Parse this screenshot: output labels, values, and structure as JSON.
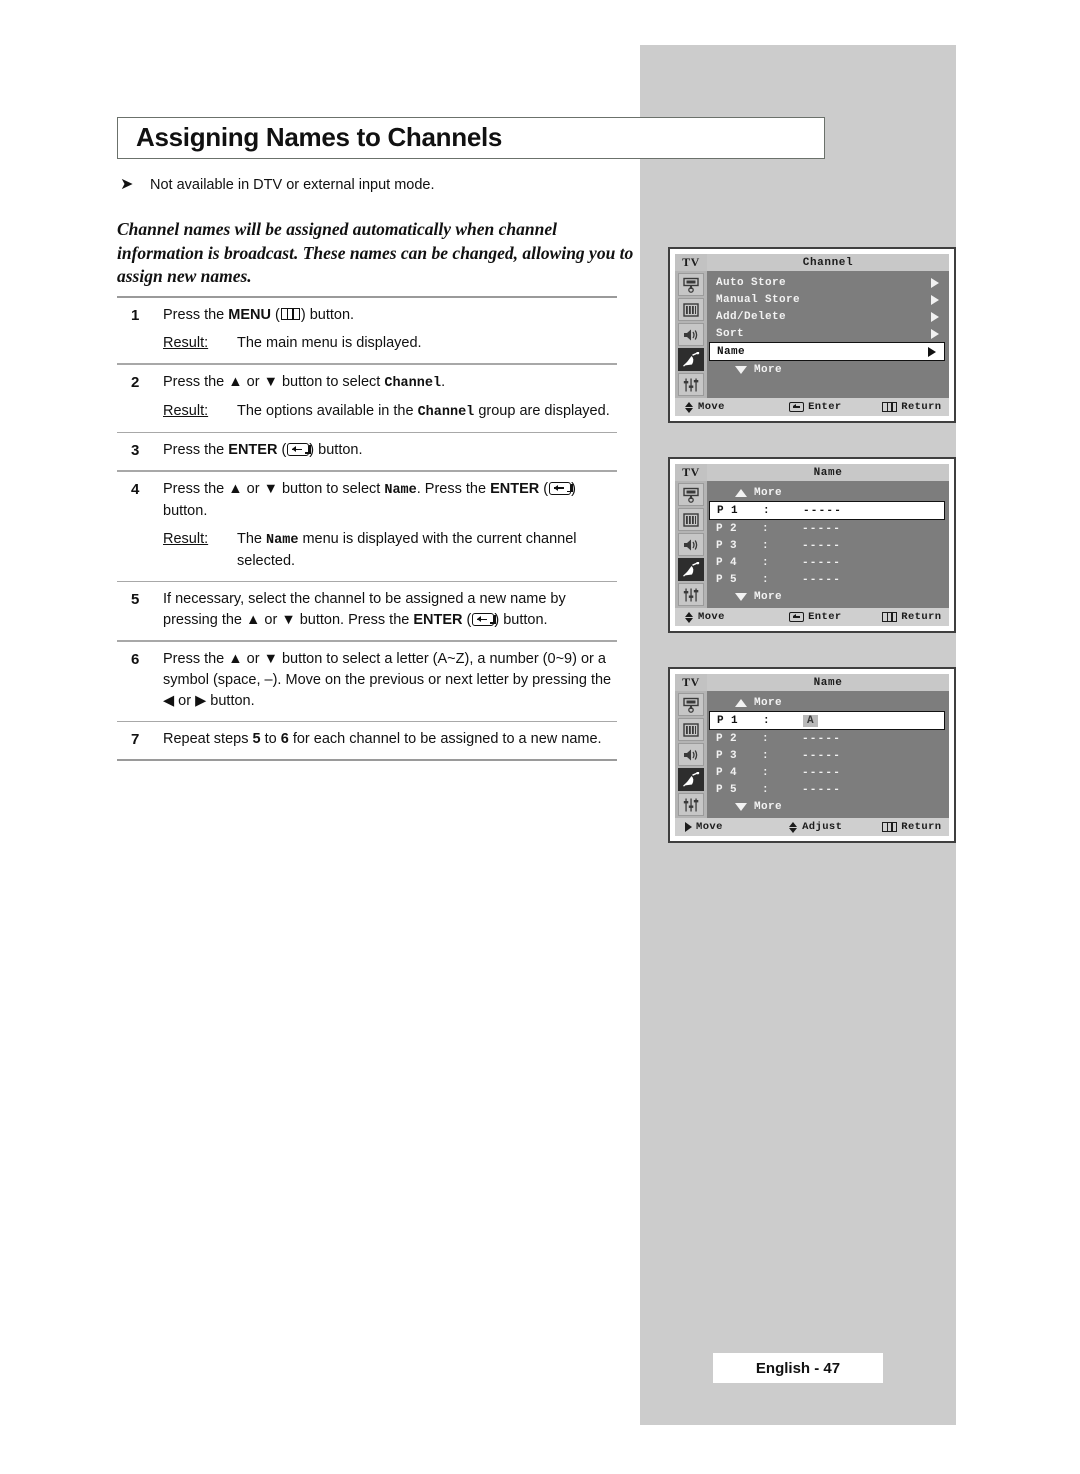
{
  "page": {
    "title": "Assigning Names to Channels",
    "note": "Not available in DTV or external input mode.",
    "intro": "Channel names will be assigned automatically when channel information is broadcast. These names can be changed, allowing you to assign new names.",
    "footer": "English - 47"
  },
  "labels": {
    "result": "Result:",
    "press_the": "Press the ",
    "menu": "MENU",
    "enter": "ENTER",
    "button_suffix": " button."
  },
  "steps": [
    {
      "num": "1",
      "text_a": "Press the ",
      "kw": "MENU",
      "icon": "menu-icon",
      "text_b": " button.",
      "result_label": "Result:",
      "result": "The main menu is displayed."
    },
    {
      "num": "2",
      "text_a": "Press the ▲ or ▼ button to select ",
      "mono": "Channel",
      "text_b": ".",
      "result_label": "Result:",
      "result_a": "The options available in the ",
      "result_mono": "Channel",
      "result_b": " group are displayed."
    },
    {
      "num": "3",
      "text_a": "Press the ",
      "kw": "ENTER",
      "icon": "enter-icon",
      "text_b": " button."
    },
    {
      "num": "4",
      "text_a": "Press the ▲ or ▼ button to select ",
      "mono": "Name",
      "text_b": ". Press the ",
      "kw": "ENTER",
      "icon": "enter-icon",
      "text_c": " button.",
      "result_label": "Result:",
      "result_a": "The ",
      "result_mono": "Name",
      "result_b": " menu is displayed with the current channel selected."
    },
    {
      "num": "5",
      "text_a": "If necessary, select the channel to be assigned a new name by pressing the ▲ or ▼ button. Press the ",
      "kw": "ENTER",
      "icon": "enter-icon",
      "text_b": " button."
    },
    {
      "num": "6",
      "text_a": "Press the ▲ or ▼ button to select a letter (A~Z), a number (0~9) or a symbol (space, –). Move on the previous or next letter by pressing the ◀ or ▶ button."
    },
    {
      "num": "7",
      "text_a": "Repeat steps ",
      "b1": "5",
      "text_b": " to ",
      "b2": "6",
      "text_c": " for each channel to be assigned to a new name."
    }
  ],
  "osd": {
    "tv_label": "TV",
    "rail_icons": [
      "osd-input-icon",
      "picture-icon",
      "sound-icon",
      "channel-dish-icon",
      "setup-sliders-icon"
    ],
    "screens": [
      {
        "name": "channel-menu",
        "title": "Channel",
        "rows": [
          {
            "label": "Auto Store",
            "caret": true,
            "selected": false
          },
          {
            "label": "Manual Store",
            "caret": true,
            "selected": false
          },
          {
            "label": "Add/Delete",
            "caret": true,
            "selected": false
          },
          {
            "label": "Sort",
            "caret": true,
            "selected": false
          },
          {
            "label": "Name",
            "caret": true,
            "selected": true
          }
        ],
        "more_top": null,
        "more_bottom": "More",
        "bottom": [
          {
            "icon": "updown-icon",
            "label": "Move"
          },
          {
            "icon": "enter-icon",
            "label": "Enter"
          },
          {
            "icon": "menu-icon",
            "label": "Return"
          }
        ]
      },
      {
        "name": "name-list-menu",
        "title": "Name",
        "more_top": "More",
        "more_bottom": "More",
        "channels": [
          {
            "pno": "P 1",
            "colon": ":",
            "value": "-----",
            "selected": true,
            "char": null
          },
          {
            "pno": "P 2",
            "colon": ":",
            "value": "-----",
            "selected": false,
            "char": null
          },
          {
            "pno": "P 3",
            "colon": ":",
            "value": "-----",
            "selected": false,
            "char": null
          },
          {
            "pno": "P 4",
            "colon": ":",
            "value": "-----",
            "selected": false,
            "char": null
          },
          {
            "pno": "P 5",
            "colon": ":",
            "value": "-----",
            "selected": false,
            "char": null
          }
        ],
        "bottom": [
          {
            "icon": "updown-icon",
            "label": "Move"
          },
          {
            "icon": "enter-icon",
            "label": "Enter"
          },
          {
            "icon": "menu-icon",
            "label": "Return"
          }
        ]
      },
      {
        "name": "name-edit-menu",
        "title": "Name",
        "more_top": "More",
        "more_bottom": "More",
        "channels": [
          {
            "pno": "P 1",
            "colon": ":",
            "value": "",
            "selected": true,
            "char": "A"
          },
          {
            "pno": "P 2",
            "colon": ":",
            "value": "-----",
            "selected": false,
            "char": null
          },
          {
            "pno": "P 3",
            "colon": ":",
            "value": "-----",
            "selected": false,
            "char": null
          },
          {
            "pno": "P 4",
            "colon": ":",
            "value": "-----",
            "selected": false,
            "char": null
          },
          {
            "pno": "P 5",
            "colon": ":",
            "value": "-----",
            "selected": false,
            "char": null
          }
        ],
        "bottom": [
          {
            "icon": "right-arrow-icon",
            "label": "Move"
          },
          {
            "icon": "updown-icon",
            "label": "Adjust"
          },
          {
            "icon": "menu-icon",
            "label": "Return"
          }
        ]
      }
    ]
  },
  "colors": {
    "panel_grey": "#cccccc",
    "osd_body": "#7d7d7d",
    "osd_header": "#c8c8c8",
    "osd_bottom": "#cfcfcf",
    "rail": "#b4b4b4",
    "selected_row": "#ffffff"
  }
}
